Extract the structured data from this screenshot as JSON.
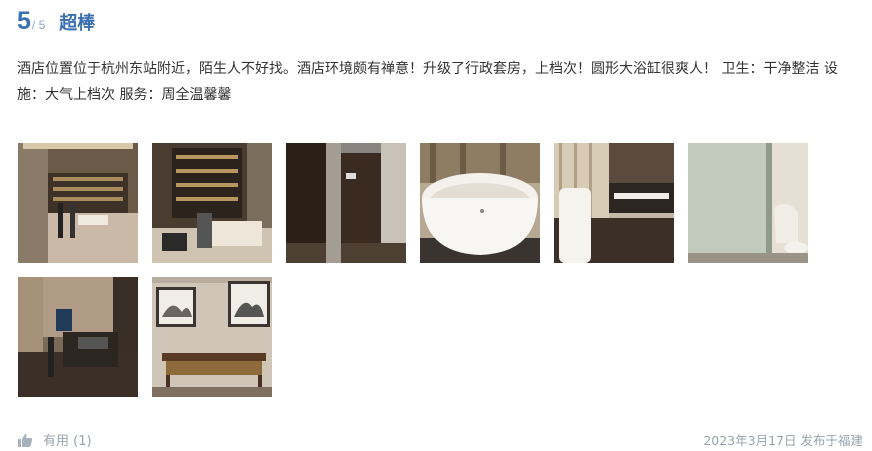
{
  "review": {
    "score": "5",
    "score_max": "/ 5",
    "score_label": "超棒",
    "text": "酒店位置位于杭州东站附近，陌生人不好找。酒店环境颇有禅意！升级了行政套房，上档次！圆形大浴缸很爽人！ 卫生：干净整洁 设施：大气上档次 服务：周全温馨馨",
    "photos": [
      {
        "name": "lobby-photo"
      },
      {
        "name": "living-room-photo"
      },
      {
        "name": "hallway-door-photo"
      },
      {
        "name": "round-bathtub-photo"
      },
      {
        "name": "bathroom-vanity-photo"
      },
      {
        "name": "toilet-photo"
      },
      {
        "name": "bedroom-tv-photo"
      },
      {
        "name": "artwork-console-photo"
      }
    ],
    "helpful_label": "有用 (1)",
    "date": "2023年3月17日",
    "posted_from": "发布于福建"
  },
  "colors": {
    "accent": "#3a6fb0",
    "muted": "#9aa3ad"
  }
}
